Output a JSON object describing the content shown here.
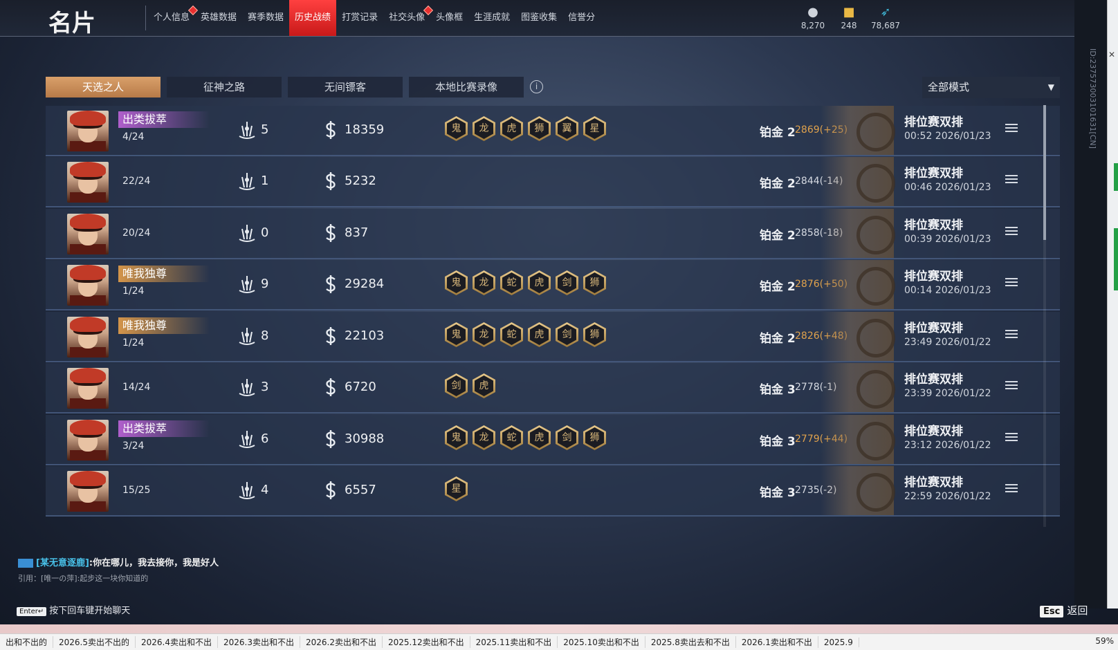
{
  "page_title": "名片",
  "nav": [
    {
      "label": "个人信息",
      "dot": true
    },
    {
      "label": "英雄数据",
      "dot": false
    },
    {
      "label": "赛季数据",
      "dot": false
    },
    {
      "label": "历史战绩",
      "dot": false,
      "active": true
    },
    {
      "label": "打赏记录",
      "dot": false
    },
    {
      "label": "社交头像",
      "dot": true
    },
    {
      "label": "头像框",
      "dot": false
    },
    {
      "label": "生涯成就",
      "dot": false
    },
    {
      "label": "图鉴收集",
      "dot": false
    },
    {
      "label": "信誉分",
      "dot": false
    }
  ],
  "currencies": [
    {
      "icon": "coin-bag-icon",
      "value": "8,270"
    },
    {
      "icon": "gold-chest-icon",
      "value": "248"
    },
    {
      "icon": "feather-icon",
      "value": "78,687"
    }
  ],
  "uid": "ID:237573003101631[CN]",
  "tabs": [
    "天选之人",
    "征神之路",
    "无间镖客",
    "本地比赛录像"
  ],
  "mode_select": "全部模式",
  "matches": [
    {
      "title": "出类拔萃",
      "title_color": "purple",
      "rank": "4/24",
      "kills": "5",
      "gold": "18359",
      "badges": [
        "鬼",
        "龙",
        "虎",
        "狮",
        "翼",
        "星"
      ],
      "tier": "铂金 2",
      "score": "2869(+25)",
      "positive": true,
      "mode": "排位赛双排",
      "time": "00:52  2026/01/23"
    },
    {
      "title": "",
      "title_color": "",
      "rank": "22/24",
      "kills": "1",
      "gold": "5232",
      "badges": [],
      "tier": "铂金 2",
      "score": "2844(-14)",
      "positive": false,
      "mode": "排位赛双排",
      "time": "00:46  2026/01/23"
    },
    {
      "title": "",
      "title_color": "",
      "rank": "20/24",
      "kills": "0",
      "gold": "837",
      "badges": [],
      "tier": "铂金 2",
      "score": "2858(-18)",
      "positive": false,
      "mode": "排位赛双排",
      "time": "00:39  2026/01/23"
    },
    {
      "title": "唯我独尊",
      "title_color": "gold",
      "rank": "1/24",
      "kills": "9",
      "gold": "29284",
      "badges": [
        "鬼",
        "龙",
        "蛇",
        "虎",
        "剑",
        "狮"
      ],
      "tier": "铂金 2",
      "score": "2876(+50)",
      "positive": true,
      "mode": "排位赛双排",
      "time": "00:14  2026/01/23"
    },
    {
      "title": "唯我独尊",
      "title_color": "gold",
      "rank": "1/24",
      "kills": "8",
      "gold": "22103",
      "badges": [
        "鬼",
        "龙",
        "蛇",
        "虎",
        "剑",
        "狮"
      ],
      "tier": "铂金 2",
      "score": "2826(+48)",
      "positive": true,
      "mode": "排位赛双排",
      "time": "23:49  2026/01/22"
    },
    {
      "title": "",
      "title_color": "",
      "rank": "14/24",
      "kills": "3",
      "gold": "6720",
      "badges": [
        "剑",
        "虎"
      ],
      "tier": "铂金 3",
      "score": "2778(-1)",
      "positive": false,
      "mode": "排位赛双排",
      "time": "23:39  2026/01/22"
    },
    {
      "title": "出类拔萃",
      "title_color": "purple",
      "rank": "3/24",
      "kills": "6",
      "gold": "30988",
      "badges": [
        "鬼",
        "龙",
        "蛇",
        "虎",
        "剑",
        "狮"
      ],
      "tier": "铂金 3",
      "score": "2779(+44)",
      "positive": true,
      "mode": "排位赛双排",
      "time": "23:12  2026/01/22"
    },
    {
      "title": "",
      "title_color": "",
      "rank": "15/25",
      "kills": "4",
      "gold": "6557",
      "badges": [
        "星"
      ],
      "tier": "铂金 3",
      "score": "2735(-2)",
      "positive": false,
      "mode": "排位赛双排",
      "time": "22:59  2026/01/22"
    }
  ],
  "chat": {
    "name": "[某无意逐鹿]",
    "message": "你在哪儿，我去接你，我是好人",
    "quote": "引用：[唯一の萍]:起步这一块你知道的"
  },
  "enter_hint": {
    "key": "Enter↵",
    "text": "按下回车键开始聊天"
  },
  "esc": {
    "key": "Esc",
    "label": "返回"
  },
  "taskbar": {
    "items": [
      "出和不出的",
      "2026.5卖出不出的",
      "2026.4卖出和不出",
      "2026.3卖出和不出",
      "2026.2卖出和不出",
      "2025.12卖出和不出",
      "2025.11卖出和不出",
      "2025.10卖出和不出",
      "2025.8卖出去和不出",
      "2026.1卖出和不出",
      "2025.9"
    ],
    "zoom": "59%"
  }
}
